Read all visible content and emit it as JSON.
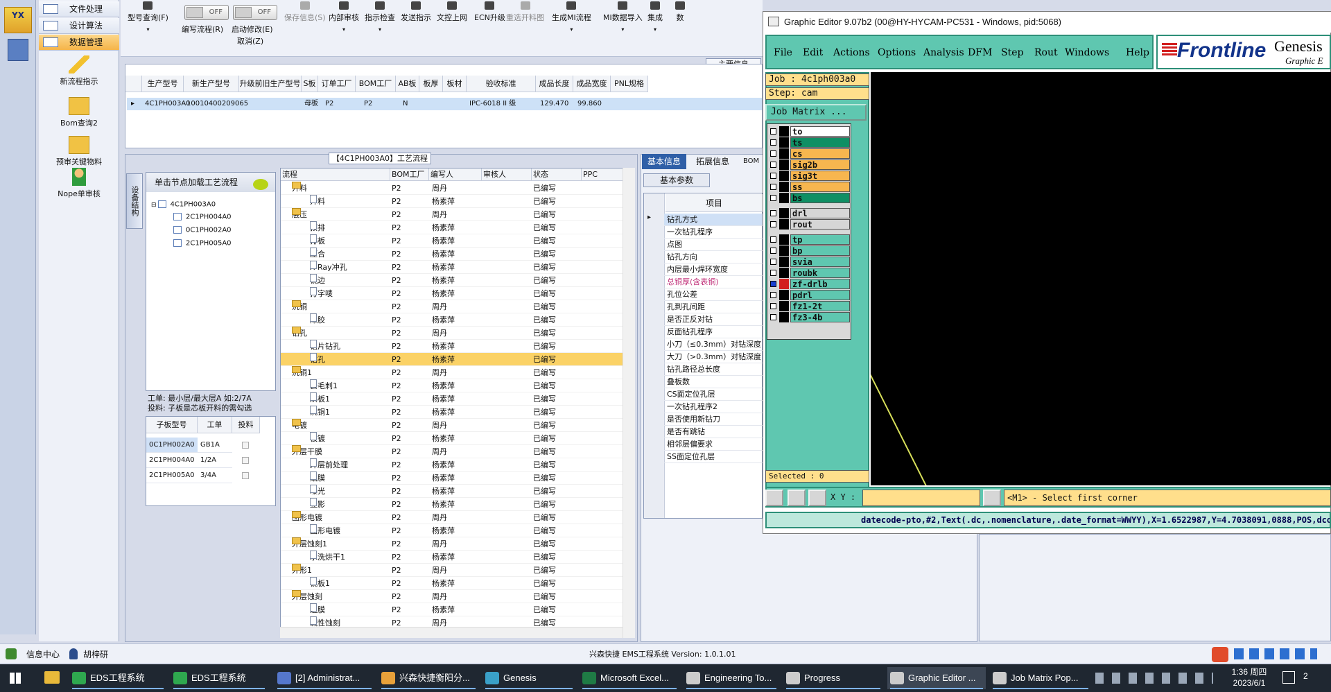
{
  "nav": {
    "logo_text": "YX",
    "items": [
      {
        "label": "文件处理"
      },
      {
        "label": "设计算法"
      },
      {
        "label": "数据管理"
      }
    ],
    "tools": [
      {
        "label": "新流程指示",
        "icon": "lightning-icon"
      },
      {
        "label": "Bom查询2",
        "icon": "folder-icon"
      },
      {
        "label": "预审关键物料",
        "icon": "folder-icon"
      },
      {
        "label": "Nope单审核",
        "icon": "user-icon"
      }
    ]
  },
  "toolbar": {
    "buttons": [
      {
        "label": "型号查询(F)"
      },
      {
        "label": "保存信息(S)"
      },
      {
        "label": "内部审核"
      },
      {
        "label": "指示检查"
      },
      {
        "label": "发送指示"
      },
      {
        "label": "文控上网"
      },
      {
        "label": "ECN升级"
      },
      {
        "label": "重选开料图"
      },
      {
        "label": "生成MI流程"
      },
      {
        "label": "MI数据导入"
      },
      {
        "label": "集成"
      },
      {
        "label": "数"
      }
    ],
    "toggles": [
      {
        "state": "OFF",
        "label": "编写流程(R)"
      },
      {
        "state": "OFF",
        "label": "启动修改(E)"
      }
    ],
    "extra_label": "取消(Z)"
  },
  "top_grid": {
    "section_label": "主要信息",
    "columns": [
      "生产型号",
      "新生产型号",
      "升级前旧生产型号",
      "S板",
      "订单工厂",
      "BOM工厂",
      "AB板",
      "板厚",
      "板材",
      "验收标准",
      "成品长度",
      "成品宽度",
      "PNL规格"
    ],
    "row": [
      "4C1PH003A0",
      "10010400209065",
      "",
      "母板",
      "P2",
      "P2",
      "N",
      "",
      "",
      "IPC-6018 II 级",
      "129.470",
      "99.860",
      ""
    ]
  },
  "process_panel": {
    "title": "【4C1PH003A0】工艺流程",
    "vertical_tab": "设备结构",
    "tree_header": "单击节点加载工艺流程",
    "tree": [
      {
        "label": "4C1PH003A0",
        "level": 0
      },
      {
        "label": "2C1PH004A0",
        "level": 1
      },
      {
        "label": "0C1PH002A0",
        "level": 1
      },
      {
        "label": "2C1PH005A0",
        "level": 1
      }
    ],
    "note_line1": "工单: 最小层/最大层A 如:2/7A",
    "note_line2": "投料: 子板是芯板开料的需勾选",
    "sub_grid": {
      "columns": [
        "子板型号",
        "工单",
        "投料"
      ],
      "rows": [
        {
          "model": "0C1PH002A0",
          "order": "GB1A",
          "checked": true
        },
        {
          "model": "2C1PH004A0",
          "order": "1/2A",
          "checked": true
        },
        {
          "model": "2C1PH005A0",
          "order": "3/4A",
          "checked": true
        }
      ]
    },
    "grid_columns": [
      "流程",
      "BOM工厂",
      "编写人",
      "审核人",
      "状态",
      "PPC"
    ],
    "rows": [
      {
        "name": "开料",
        "folder": true,
        "factory": "P2",
        "author": "周丹",
        "status": "已编写"
      },
      {
        "name": "开料",
        "folder": false,
        "factory": "P2",
        "author": "杨素萍",
        "status": "已编写"
      },
      {
        "name": "层压",
        "folder": true,
        "factory": "P2",
        "author": "周丹",
        "status": "已编写"
      },
      {
        "name": "预排",
        "folder": false,
        "factory": "P2",
        "author": "杨素萍",
        "status": "已编写"
      },
      {
        "name": "排板",
        "folder": false,
        "factory": "P2",
        "author": "杨素萍",
        "status": "已编写"
      },
      {
        "name": "压合",
        "folder": false,
        "factory": "P2",
        "author": "杨素萍",
        "status": "已编写"
      },
      {
        "name": "X-Ray冲孔",
        "folder": false,
        "factory": "P2",
        "author": "杨素萍",
        "status": "已编写"
      },
      {
        "name": "铣边",
        "folder": false,
        "factory": "P2",
        "author": "杨素萍",
        "status": "已编写"
      },
      {
        "name": "打字唛",
        "folder": false,
        "factory": "P2",
        "author": "杨素萍",
        "status": "已编写"
      },
      {
        "name": "沉铜",
        "folder": true,
        "factory": "P2",
        "author": "周丹",
        "status": "已编写"
      },
      {
        "name": "除胶",
        "folder": false,
        "factory": "P2",
        "author": "杨素萍",
        "status": "已编写"
      },
      {
        "name": "钻孔",
        "folder": true,
        "factory": "P2",
        "author": "周丹",
        "status": "已编写"
      },
      {
        "name": "铝片钻孔",
        "folder": false,
        "factory": "P2",
        "author": "杨素萍",
        "status": "已编写"
      },
      {
        "name": "钻孔",
        "folder": false,
        "factory": "P2",
        "author": "杨素萍",
        "status": "已编写",
        "selected": true
      },
      {
        "name": "沉铜1",
        "folder": true,
        "factory": "P2",
        "author": "周丹",
        "status": "已编写"
      },
      {
        "name": "去毛刺1",
        "folder": false,
        "factory": "P2",
        "author": "杨素萍",
        "status": "已编写"
      },
      {
        "name": "烘板1",
        "folder": false,
        "factory": "P2",
        "author": "杨素萍",
        "status": "已编写"
      },
      {
        "name": "沉铜1",
        "folder": false,
        "factory": "P2",
        "author": "杨素萍",
        "status": "已编写"
      },
      {
        "name": "电镀",
        "folder": true,
        "factory": "P2",
        "author": "周丹",
        "status": "已编写"
      },
      {
        "name": "板镀",
        "folder": false,
        "factory": "P2",
        "author": "杨素萍",
        "status": "已编写"
      },
      {
        "name": "外层干膜",
        "folder": true,
        "factory": "P2",
        "author": "周丹",
        "status": "已编写"
      },
      {
        "name": "外层前处理",
        "folder": false,
        "factory": "P2",
        "author": "杨素萍",
        "status": "已编写"
      },
      {
        "name": "贴膜",
        "folder": false,
        "factory": "P2",
        "author": "杨素萍",
        "status": "已编写"
      },
      {
        "name": "曝光",
        "folder": false,
        "factory": "P2",
        "author": "杨素萍",
        "status": "已编写"
      },
      {
        "name": "显影",
        "folder": false,
        "factory": "P2",
        "author": "杨素萍",
        "status": "已编写"
      },
      {
        "name": "图形电镀",
        "folder": true,
        "factory": "P2",
        "author": "周丹",
        "status": "已编写"
      },
      {
        "name": "图形电镀",
        "folder": false,
        "factory": "P2",
        "author": "杨素萍",
        "status": "已编写"
      },
      {
        "name": "外层蚀刻1",
        "folder": true,
        "factory": "P2",
        "author": "周丹",
        "status": "已编写"
      },
      {
        "name": "水洗烘干1",
        "folder": false,
        "factory": "P2",
        "author": "杨素萍",
        "status": "已编写"
      },
      {
        "name": "外形1",
        "folder": true,
        "factory": "P2",
        "author": "周丹",
        "status": "已编写"
      },
      {
        "name": "铣板1",
        "folder": false,
        "factory": "P2",
        "author": "杨素萍",
        "status": "已编写"
      },
      {
        "name": "外层蚀刻",
        "folder": true,
        "factory": "P2",
        "author": "周丹",
        "status": "已编写"
      },
      {
        "name": "退膜",
        "folder": false,
        "factory": "P2",
        "author": "杨素萍",
        "status": "已编写"
      },
      {
        "name": "碱性蚀刻",
        "folder": false,
        "factory": "P2",
        "author": "周丹",
        "status": "已编写"
      }
    ]
  },
  "info_panel": {
    "tabs": [
      "基本信息",
      "拓展信息",
      "BOM"
    ],
    "subtab": "基本参数",
    "column": "项目",
    "rows": [
      {
        "label": "钻孔方式",
        "highlight": true
      },
      {
        "label": "一次钻孔程序"
      },
      {
        "label": "点图"
      },
      {
        "label": "钻孔方向"
      },
      {
        "label": "内层最小焊环宽度"
      },
      {
        "label": "总铜厚(含表铜)",
        "pink": true
      },
      {
        "label": "孔位公差"
      },
      {
        "label": "孔到孔间距"
      },
      {
        "label": "是否正反对钻"
      },
      {
        "label": "反面钻孔程序"
      },
      {
        "label": "小刀（≤0.3mm）对钻深度"
      },
      {
        "label": "大刀（>0.3mm）对钻深度"
      },
      {
        "label": "钻孔路径总长度"
      },
      {
        "label": "叠板数"
      },
      {
        "label": "CS面定位孔层"
      },
      {
        "label": "一次钻孔程序2"
      },
      {
        "label": "是否使用新钻刀"
      },
      {
        "label": "是否有跳钻"
      },
      {
        "label": "相邻层偏要求"
      },
      {
        "label": "SS面定位孔层"
      }
    ]
  },
  "graphic_editor": {
    "title": "Graphic Editor 9.07b2 (00@HY-HYCAM-PC531 - Windows, pid:5068)",
    "menu": [
      "File",
      "Edit",
      "Actions",
      "Options",
      "Analysis",
      "DFM",
      "Step",
      "Rout",
      "Windows",
      "Help"
    ],
    "brand": "Frontline",
    "brand_right": "Genesis",
    "brand_sub": "Graphic E",
    "job": "Job : 4c1ph003a0",
    "step": "Step: cam",
    "job_matrix": "Job Matrix ...",
    "layers": [
      {
        "name": "to",
        "color": "#ffffff"
      },
      {
        "name": "ts",
        "color": "#0f8f64"
      },
      {
        "name": "cs",
        "color": "#f7b64f"
      },
      {
        "name": "sig2b",
        "color": "#f7b64f"
      },
      {
        "name": "sig3t",
        "color": "#f7b64f"
      },
      {
        "name": "ss",
        "color": "#f7b64f"
      },
      {
        "name": "bs",
        "color": "#0f8f64"
      },
      {
        "name": "drl",
        "color": "#d6d6d6"
      },
      {
        "name": "rout",
        "color": "#d6d6d6"
      },
      {
        "name": "tp",
        "color": "#5fc7b0"
      },
      {
        "name": "bp",
        "color": "#5fc7b0"
      },
      {
        "name": "svia",
        "color": "#5fc7b0"
      },
      {
        "name": "roubk",
        "color": "#5fc7b0"
      },
      {
        "name": "zf-drlb",
        "color": "#5fc7b0",
        "active": true
      },
      {
        "name": "pdrl",
        "color": "#5fc7b0"
      },
      {
        "name": "fz1-2t",
        "color": "#5fc7b0"
      },
      {
        "name": "fz3-4b",
        "color": "#5fc7b0"
      }
    ],
    "selected": "Selected : 0",
    "xy_label": "X Y :",
    "prompt": "<M1> - Select first corner",
    "status": "datecode-pto,#2,Text(.dc,.nomenclature,.date_format=WWYY),X=1.6522987,Y=4.7038091,0888,POS,dcode-"
  },
  "app_status": {
    "left1": "信息中心",
    "left2": "胡梓研",
    "center": "兴森快捷 EMS工程系统 Version: 1.0.1.01"
  },
  "taskbar": {
    "items": [
      {
        "label": "EDS工程系统",
        "color": "#2fa84f"
      },
      {
        "label": "EDS工程系统",
        "color": "#2fa84f"
      },
      {
        "label": "[2] Administrat...",
        "color": "#5577cc"
      },
      {
        "label": "兴森快捷衡阳分...",
        "color": "#e8a13a"
      },
      {
        "label": "Genesis",
        "color": "#3aa0c8"
      },
      {
        "label": "Microsoft Excel...",
        "color": "#1f7b45"
      },
      {
        "label": "Engineering To...",
        "color": "#cccccc"
      },
      {
        "label": "Progress",
        "color": "#cccccc"
      },
      {
        "label": "Graphic Editor ...",
        "color": "#cccccc",
        "active": true
      },
      {
        "label": "Job Matrix Pop...",
        "color": "#cccccc"
      }
    ],
    "time": "1:36 周四",
    "date": "2023/6/1",
    "notify": "2"
  }
}
